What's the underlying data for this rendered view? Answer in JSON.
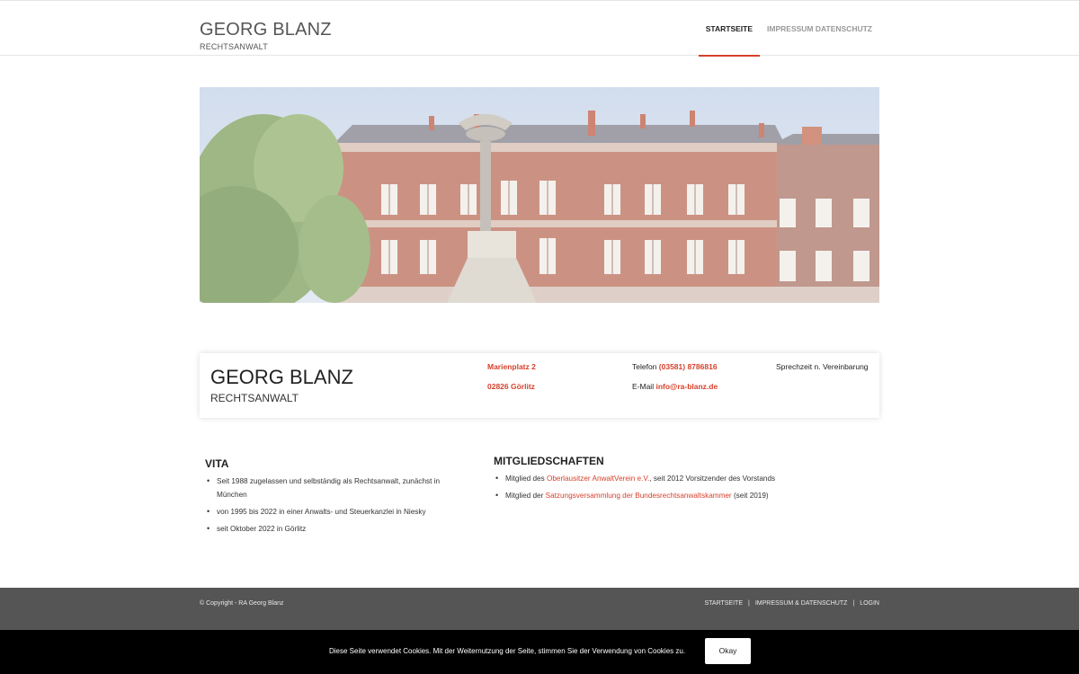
{
  "header": {
    "logo_name": "GEORG BLANZ",
    "logo_sub": "RECHTSANWALT",
    "nav": [
      {
        "label": "STARTSEITE",
        "active": true
      },
      {
        "label": "IMPRESSUM  DATENSCHUTZ",
        "active": false
      }
    ]
  },
  "hero": {
    "icon": "building-photo"
  },
  "infobox": {
    "name": "GEORG BLANZ",
    "subtitle": "RECHTSANWALT",
    "street": "Marienplatz 2",
    "city": "02826 Görlitz",
    "phone_label": "Telefon",
    "phone": "(03581) 8786816",
    "email_label": "E-Mail",
    "email": "info@ra-blanz.de",
    "hours": "Sprechzeit n. Vereinbarung"
  },
  "vita": {
    "title": "VITA",
    "items": [
      "Seit 1988 zugelassen und selbständig als Rechtsanwalt, zunächst in München",
      "von 1995 bis 2022 in einer Anwalts- und Steuerkanzlei in Niesky",
      "seit Oktober 2022 in Görlitz"
    ]
  },
  "memberships": {
    "title": "MITGLIEDSCHAFTEN",
    "item1_pre": "Mitglied des ",
    "item1_link": "Oberlausitzer AnwaltVerein e.V.",
    "item1_post": ", seit 2012 Vorsitzender des Vorstands",
    "item2_pre": "Mitglied der ",
    "item2_link": "Satzungsversammlung der Bundesrechtsanwaltskammer",
    "item2_post": " (seit 2019)"
  },
  "footer": {
    "copyright": "© Copyright - RA Georg Blanz",
    "nav": [
      "STARTSEITE",
      "IMPRESSUM & DATENSCHUTZ",
      "LOGIN"
    ],
    "separator": "|"
  },
  "cookie": {
    "text": "Diese Seite verwendet Cookies. Mit der Weiternutzung der Seite, stimmen Sie der Verwendung von Cookies zu.",
    "button": "Okay"
  },
  "colors": {
    "accent": "#d6412b",
    "footer_bg": "#555555",
    "cookie_bg": "#000000"
  }
}
